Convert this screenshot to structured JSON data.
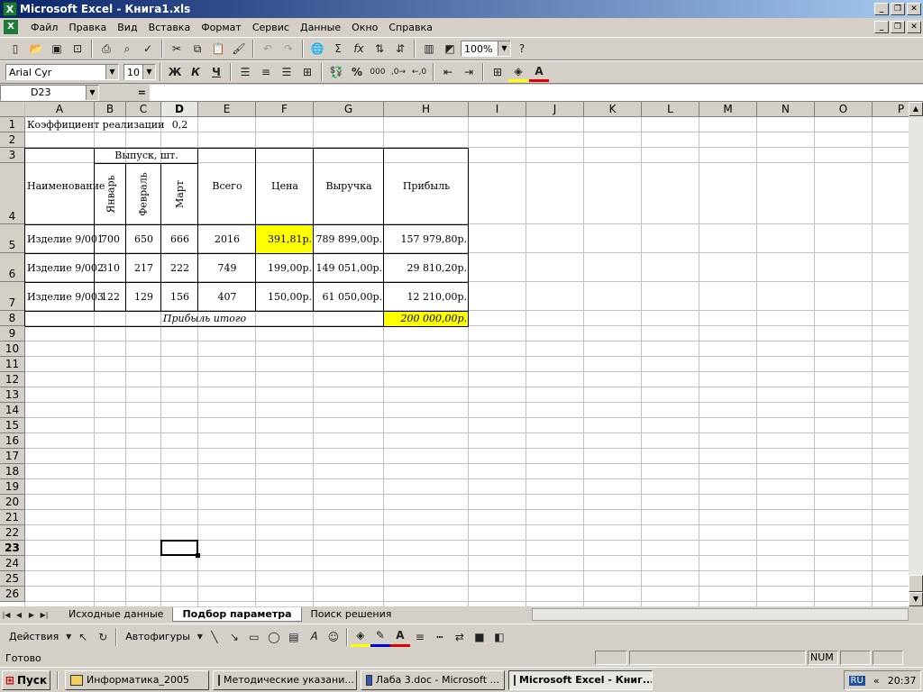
{
  "window": {
    "title": "Microsoft Excel - Книга1.xls"
  },
  "menu": [
    "Файл",
    "Правка",
    "Вид",
    "Вставка",
    "Формат",
    "Сервис",
    "Данные",
    "Окно",
    "Справка"
  ],
  "toolbar": {
    "zoom": "100%"
  },
  "format_toolbar": {
    "font": "Arial Cyr",
    "size": "10",
    "bold": "Ж",
    "italic": "К",
    "underline": "Ч",
    "percent": "%",
    "thousands": "000"
  },
  "formula_bar": {
    "name_box": "D23",
    "equals": "=",
    "value": ""
  },
  "columns": [
    "A",
    "B",
    "C",
    "D",
    "E",
    "F",
    "G",
    "H",
    "I",
    "J",
    "K",
    "L",
    "M",
    "N",
    "O",
    "P"
  ],
  "rows": [
    "1",
    "2",
    "3",
    "4",
    "5",
    "6",
    "7",
    "8",
    "9",
    "10",
    "11",
    "12",
    "13",
    "14",
    "15",
    "16",
    "17",
    "18",
    "19",
    "20",
    "21",
    "22",
    "23",
    "24",
    "25",
    "26"
  ],
  "cells": {
    "a1": "Коэффициент реализации",
    "d1": "0,2",
    "b3": "Выпуск, шт.",
    "a4": "Наименование",
    "b4": "Январь",
    "c4": "Февраль",
    "d4": "Март",
    "e4": "Всего",
    "f4": "Цена",
    "g4": "Выручка",
    "h4": "Прибыль",
    "rows": [
      {
        "name": "Изделие 9/001",
        "b": "700",
        "c": "650",
        "d": "666",
        "e": "2016",
        "f": "391,81р.",
        "g": "789 899,00р.",
        "h": "157 979,80р."
      },
      {
        "name": "Изделие 9/002",
        "b": "310",
        "c": "217",
        "d": "222",
        "e": "749",
        "f": "199,00р.",
        "g": "149 051,00р.",
        "h": "29 810,20р."
      },
      {
        "name": "Изделие 9/003",
        "b": "122",
        "c": "129",
        "d": "156",
        "e": "407",
        "f": "150,00р.",
        "g": "61 050,00р.",
        "h": "12 210,00р."
      }
    ],
    "a8": "Прибыль итого",
    "h8": "200 000,00р."
  },
  "colors": {
    "highlight": "#ffff00",
    "title_bar": "#0a246a"
  },
  "sheet_tabs": [
    "Исходные данные",
    "Подбор параметра",
    "Поиск решения"
  ],
  "active_sheet": "Подбор параметра",
  "draw_toolbar": {
    "actions": "Действия",
    "autoshapes": "Автофигуры"
  },
  "status": {
    "ready": "Готово",
    "num": "NUM"
  },
  "taskbar": {
    "start": "Пуск",
    "tasks": [
      "Информатика_2005",
      "Методические указани...",
      "Лаба 3.doc - Microsoft ...",
      "Microsoft Excel - Книг..."
    ],
    "lang": "RU",
    "time": "20:37"
  }
}
